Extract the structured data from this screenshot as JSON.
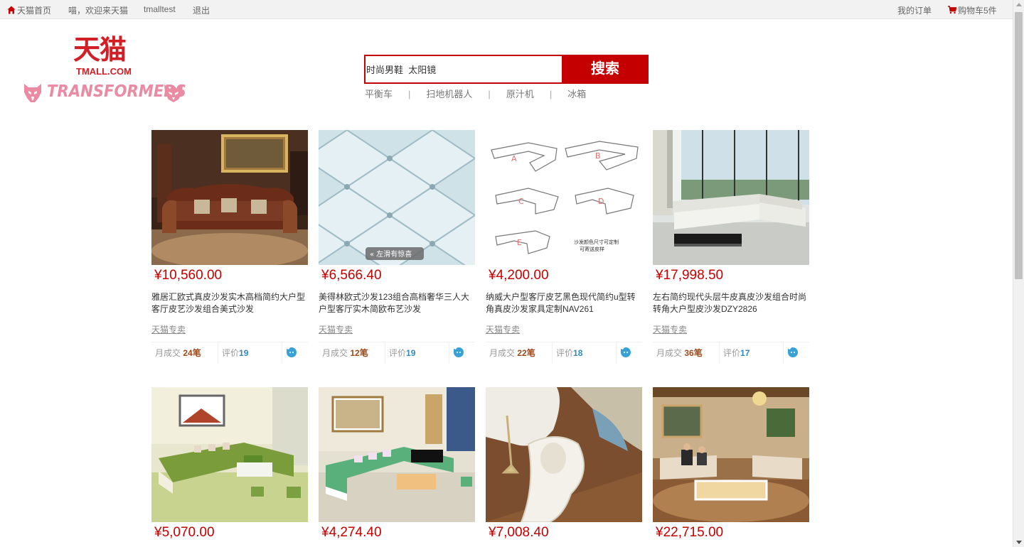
{
  "topbar": {
    "home": "天猫首页",
    "welcome": "喵，欢迎来天猫",
    "user": "tmalltest",
    "logout": "退出",
    "orders": "我的订单",
    "cart": "购物车5件"
  },
  "logo": {
    "cn": "天猫",
    "en": "TMALL.COM",
    "campaign": "TRANSFORMERS"
  },
  "search": {
    "value": "时尚男鞋  太阳镜",
    "button": "搜索",
    "hotwords": [
      "平衡车",
      "扫地机器人",
      "原汁机",
      "冰箱"
    ]
  },
  "colors": {
    "accent": "#c40000",
    "sales": "#9c4a1b",
    "reviews": "#3388bb"
  },
  "products": [
    {
      "price": "¥10,560.00",
      "title": "雅居汇欧式真皮沙发实木高档简约大户型客厅皮艺沙发组合美式沙发",
      "shop": "天猫专卖",
      "sales_label": "月成交",
      "sales": "24笔",
      "review_label": "评价",
      "reviews": "19"
    },
    {
      "price": "¥6,566.40",
      "title": "美得林欧式沙发123组合高档奢华三人大户型客厅实木简欧布艺沙发",
      "shop": "天猫专卖",
      "sales_label": "月成交",
      "sales": "12笔",
      "review_label": "评价",
      "reviews": "19",
      "img_overlay": "左滑有惊喜"
    },
    {
      "price": "¥4,200.00",
      "title": "纳威大户型客厅皮艺黑色现代简约u型转角真皮沙发家具定制NAV261",
      "shop": "天猫专卖",
      "sales_label": "月成交",
      "sales": "22笔",
      "review_label": "评价",
      "reviews": "18",
      "img_caption": "沙发颜色尺寸可定制 可寄送皮样"
    },
    {
      "price": "¥17,998.50",
      "title": "左右简约现代头层牛皮真皮沙发组合时尚转角大户型皮沙发DZY2826",
      "shop": "天猫专卖",
      "sales_label": "月成交",
      "sales": "36笔",
      "review_label": "评价",
      "reviews": "17"
    },
    {
      "price": "¥5,070.00"
    },
    {
      "price": "¥4,274.40"
    },
    {
      "price": "¥7,008.40"
    },
    {
      "price": "¥22,715.00"
    }
  ]
}
